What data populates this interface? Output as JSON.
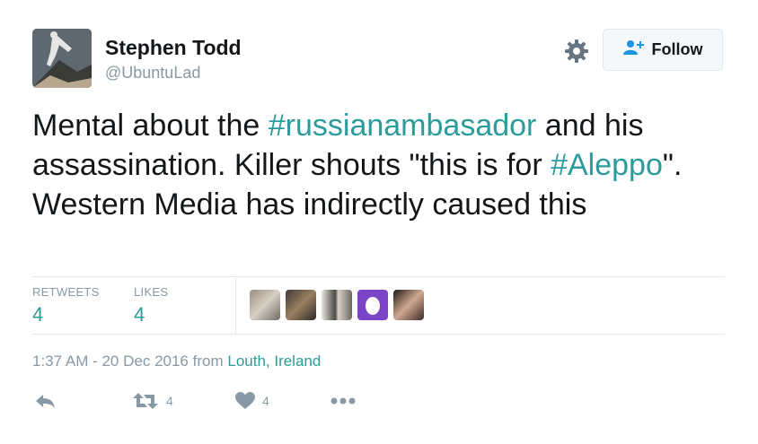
{
  "user": {
    "name": "Stephen Todd",
    "handle": "@UbuntuLad"
  },
  "follow_label": "Follow",
  "tweet": {
    "part1": "Mental about the ",
    "hashtag1": "#russianambasador",
    "part2": " and his assassination. Killer shouts \"this is for ",
    "hashtag2": "#Aleppo",
    "part3": "\". Western Media has indirectly caused this"
  },
  "stats": {
    "retweets_label": "RETWEETS",
    "retweets_value": "4",
    "likes_label": "LIKES",
    "likes_value": "4"
  },
  "timestamp": "1:37 AM - 20 Dec 2016",
  "from_word": "from",
  "location": "Louth, Ireland",
  "actions": {
    "retweet_count": "4",
    "like_count": "4"
  },
  "colors": {
    "accent": "#2b9c9a",
    "muted": "#8899a6",
    "egg_avatar": "#7b44c6"
  },
  "icons": [
    "gear-icon",
    "follow-person-icon",
    "reply-icon",
    "retweet-icon",
    "heart-icon",
    "more-icon"
  ]
}
